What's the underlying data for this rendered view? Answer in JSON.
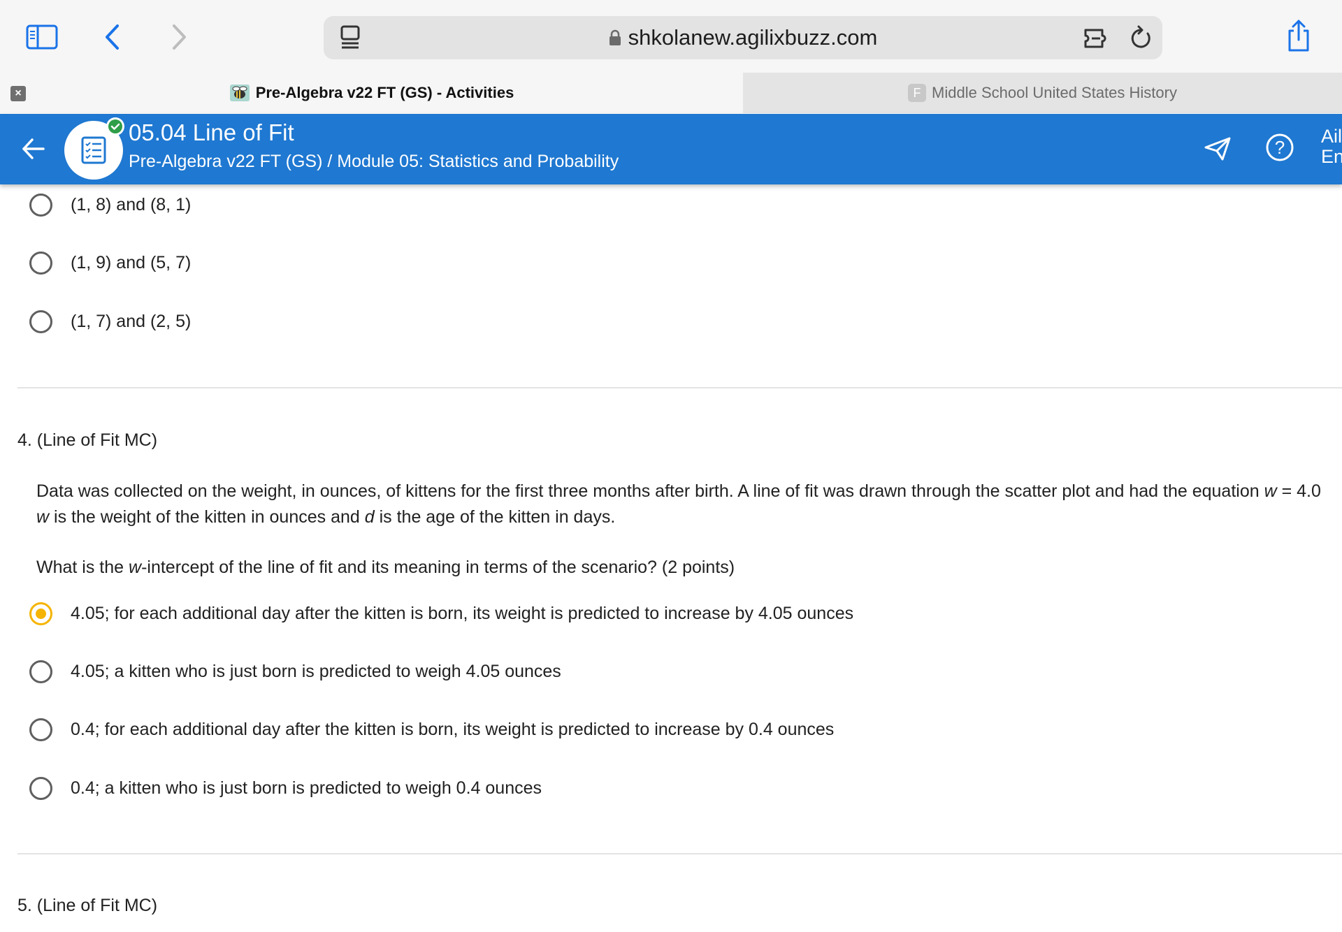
{
  "browser": {
    "url": "shkolanew.agilixbuzz.com",
    "tabs": [
      {
        "label": "Pre-Algebra v22 FT (GS) - Activities",
        "active": true
      },
      {
        "label": "Middle School United States History",
        "favicon_letter": "F",
        "active": false
      }
    ],
    "icons": [
      "sidebar-icon",
      "back-chevron-icon",
      "forward-chevron-icon",
      "tab-overview-icon",
      "lock-icon",
      "extension-icon",
      "reload-icon",
      "share-icon",
      "tab-close-icon"
    ]
  },
  "header": {
    "title": "05.04 Line of Fit",
    "path": "Pre-Algebra v22 FT (GS) / Module 05: Statistics and Probability",
    "user_initials_line1": "Ail",
    "user_initials_line2": "En",
    "colors": {
      "bar": "#1f78d1",
      "check": "#2e9e48"
    }
  },
  "question3": {
    "options": [
      {
        "text": "(1, 8) and (8, 1)",
        "selected": false
      },
      {
        "text": "(1, 9) and (5, 7)",
        "selected": false
      },
      {
        "text": "(1, 7) and (2, 5)",
        "selected": false
      }
    ]
  },
  "question4": {
    "number": "4. (Line of Fit MC)",
    "stem_line1": "Data was collected on the weight, in ounces, of kittens for the first three months after birth. A line of fit was drawn through the scatter plot and had the equation ",
    "stem_var_w": "w",
    "stem_eq_tail": " = 4.0",
    "stem_line2_var_w": "w",
    "stem_line2_a": " is the weight of the kitten in ounces and ",
    "stem_line2_var_d": "d",
    "stem_line2_b": " is the age of the kitten in days.",
    "prompt_a": "What is the ",
    "prompt_var": "w",
    "prompt_b": "-intercept of the line of fit and its meaning in terms of the scenario? (2 points)",
    "options": [
      {
        "text": "4.05; for each additional day after the kitten is born, its weight is predicted to increase by 4.05 ounces",
        "selected": true
      },
      {
        "text": "4.05; a kitten who is just born is predicted to weigh 4.05 ounces",
        "selected": false
      },
      {
        "text": "0.4; for each additional day after the kitten is born, its weight is predicted to increase by 0.4 ounces",
        "selected": false
      },
      {
        "text": "0.4; a kitten who is just born is predicted to weigh 0.4 ounces",
        "selected": false
      }
    ],
    "selected_color": "#f5b400"
  },
  "question5": {
    "number": "5. (Line of Fit MC)"
  }
}
